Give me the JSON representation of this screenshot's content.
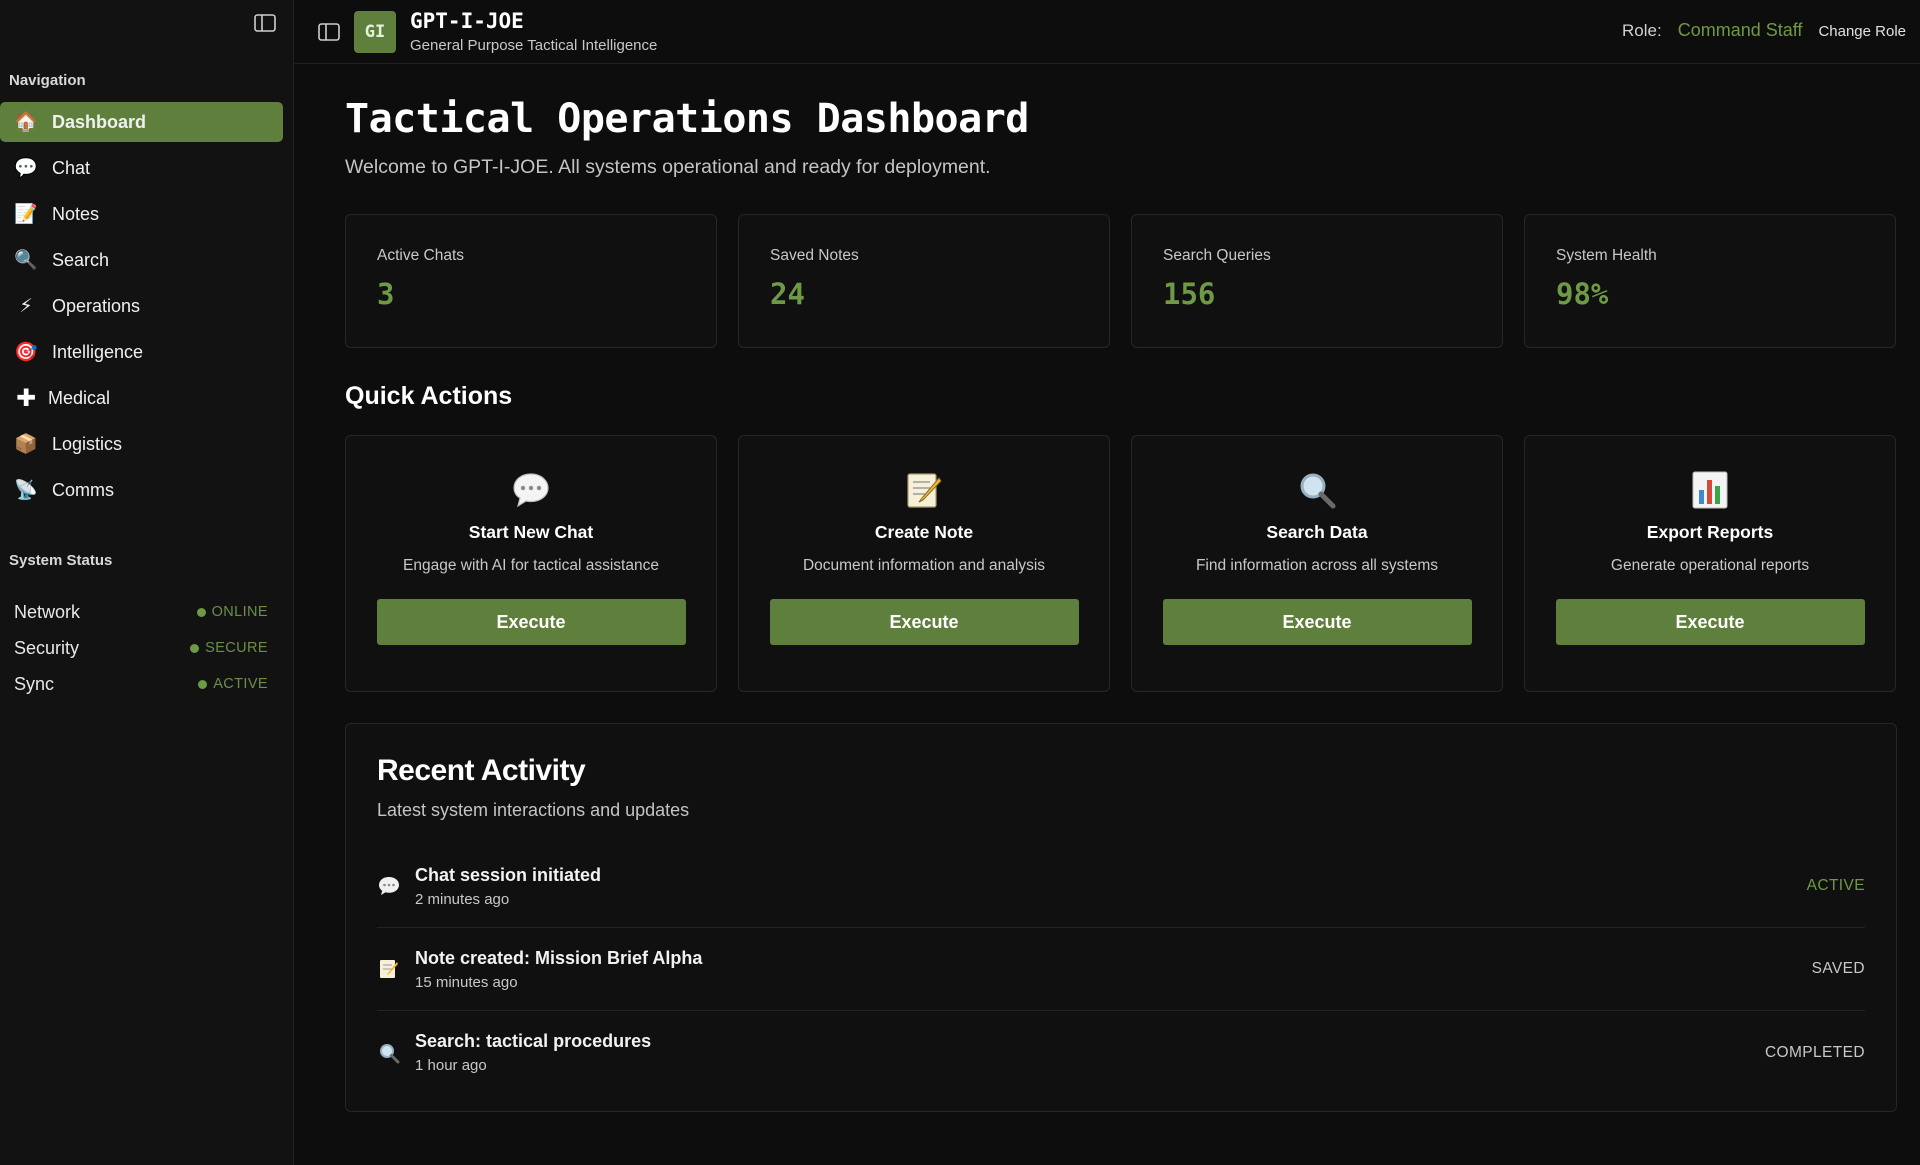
{
  "sidebar": {
    "nav_heading": "Navigation",
    "items": [
      {
        "label": "Dashboard",
        "icon": "house-icon",
        "active": true
      },
      {
        "label": "Chat",
        "icon": "speech-bubble-icon",
        "active": false
      },
      {
        "label": "Notes",
        "icon": "memo-icon",
        "active": false
      },
      {
        "label": "Search",
        "icon": "magnifier-icon",
        "active": false
      },
      {
        "label": "Operations",
        "icon": "lightning-icon",
        "active": false
      },
      {
        "label": "Intelligence",
        "icon": "target-icon",
        "active": false
      },
      {
        "label": "Medical",
        "icon": "plus-icon",
        "active": false
      },
      {
        "label": "Logistics",
        "icon": "package-icon",
        "active": false
      },
      {
        "label": "Comms",
        "icon": "satellite-icon",
        "active": false
      }
    ],
    "status_heading": "System Status",
    "status": [
      {
        "name": "Network",
        "value": "ONLINE"
      },
      {
        "name": "Security",
        "value": "SECURE"
      },
      {
        "name": "Sync",
        "value": "ACTIVE"
      }
    ]
  },
  "header": {
    "logo_text": "GI",
    "title": "GPT-I-JOE",
    "subtitle": "General Purpose Tactical Intelligence",
    "role_label": "Role:",
    "role_value": "Command Staff",
    "change_role": "Change Role"
  },
  "page": {
    "title": "Tactical Operations Dashboard",
    "subtitle": "Welcome to GPT-I-JOE. All systems operational and ready for deployment."
  },
  "stats": [
    {
      "label": "Active Chats",
      "value": "3"
    },
    {
      "label": "Saved Notes",
      "value": "24"
    },
    {
      "label": "Search Queries",
      "value": "156"
    },
    {
      "label": "System Health",
      "value": "98%"
    }
  ],
  "quick_actions": {
    "title": "Quick Actions",
    "items": [
      {
        "title": "Start New Chat",
        "desc": "Engage with AI for tactical assistance",
        "button": "Execute",
        "icon": "speech-bubble-icon"
      },
      {
        "title": "Create Note",
        "desc": "Document information and analysis",
        "button": "Execute",
        "icon": "memo-icon"
      },
      {
        "title": "Search Data",
        "desc": "Find information across all systems",
        "button": "Execute",
        "icon": "magnifier-icon"
      },
      {
        "title": "Export Reports",
        "desc": "Generate operational reports",
        "button": "Execute",
        "icon": "bar-chart-icon"
      }
    ]
  },
  "recent_activity": {
    "title": "Recent Activity",
    "subtitle": "Latest system interactions and updates",
    "items": [
      {
        "name": "Chat session initiated",
        "time": "2 minutes ago",
        "status": "ACTIVE",
        "icon": "speech-bubble-icon"
      },
      {
        "name": "Note created: Mission Brief Alpha",
        "time": "15 minutes ago",
        "status": "SAVED",
        "icon": "memo-icon"
      },
      {
        "name": "Search: tactical procedures",
        "time": "1 hour ago",
        "status": "COMPLETED",
        "icon": "magnifier-icon"
      }
    ]
  },
  "colors": {
    "accent": "#5f7f3c",
    "accent_text": "#6f9a45",
    "background": "#0d0d0d",
    "card": "#101010"
  }
}
